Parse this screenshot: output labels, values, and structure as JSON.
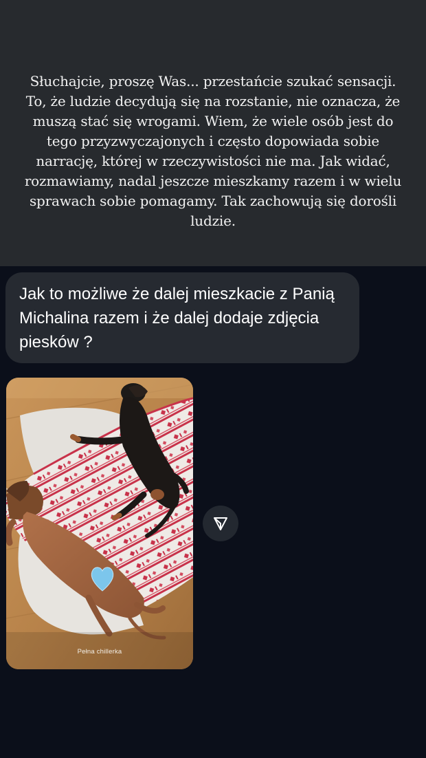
{
  "story": {
    "text": "Słuchajcie, proszę Was... przestańcie szukać sensacji. To, że ludzie decydują się na rozstanie, nie oznacza, że muszą stać się wrogami. Wiem, że wiele osób jest do tego przyzwyczajonych i często dopowiada sobie narrację, której w rzeczywistości nie ma. Jak widać, rozmawiamy, nadal jeszcze mieszkamy razem i w wielu sprawach sobie pomagamy. Tak zachowują się dorośli ludzie.",
    "background_color": "#272a2e",
    "text_color": "#f2f2f2"
  },
  "question": {
    "text": "Jak to możliwe że dalej mieszkacie z Panią Michalina razem i że dalej dodaje zdjęcia piesków ?",
    "bubble_color": "#262a31"
  },
  "shared_story": {
    "caption": "Pełna chillerka",
    "sticker_emoji": "light-blue-heart",
    "description_icons": [
      "dachshund-black",
      "dachshund-brown",
      "blanket-nordic",
      "wooden-floor"
    ]
  },
  "actions": {
    "share_icon": "send-icon"
  },
  "colors": {
    "page_background": "#0b0f1a",
    "heart": "#7cc6ec"
  }
}
